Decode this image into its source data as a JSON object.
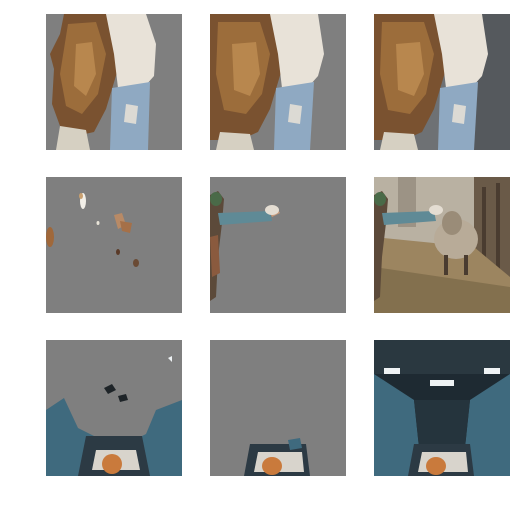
{
  "figure": {
    "rows": [
      {
        "subject": "woman-with-long-hair",
        "panels": [
          "mask-overlay-a",
          "mask-overlay-b",
          "original-photo"
        ]
      },
      {
        "subject": "person-feeding-sheep",
        "panels": [
          "mask-overlay-a",
          "mask-overlay-b",
          "original-photo"
        ]
      },
      {
        "subject": "escalator-scene",
        "panels": [
          "mask-overlay-a",
          "mask-overlay-b",
          "original-photo"
        ]
      }
    ],
    "colors": {
      "mask_gray": "#7f7f7f",
      "background": "#ffffff"
    }
  }
}
